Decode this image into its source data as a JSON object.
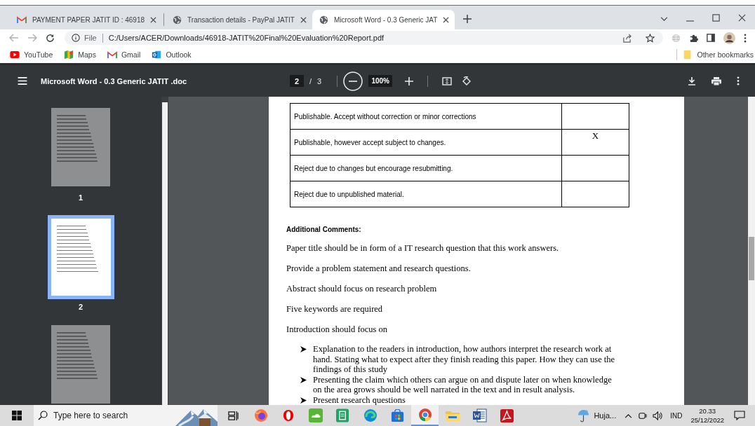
{
  "browser": {
    "tabs": [
      {
        "title": "PAYMENT PAPER JATIT ID : 46918",
        "selected": false
      },
      {
        "title": "Transaction details - PayPal JATIT",
        "selected": false
      },
      {
        "title": "Microsoft Word - 0.3 Generic JAT",
        "selected": true
      }
    ],
    "address": {
      "scheme": "File",
      "url": "C:/Users/ACER/Downloads/46918-JATIT%20Final%20Evaluation%20Report.pdf"
    },
    "bookmarks": [
      {
        "label": "YouTube"
      },
      {
        "label": "Maps"
      },
      {
        "label": "Gmail"
      },
      {
        "label": "Outlook"
      }
    ],
    "other_bookmarks": "Other bookmarks"
  },
  "pdf_toolbar": {
    "title": "Microsoft Word - 0.3 Generic JATIT .doc",
    "page": "2",
    "separator": "/",
    "page_count": "3",
    "zoom": "100%"
  },
  "thumbnails": [
    {
      "label": "1",
      "selected": false
    },
    {
      "label": "2",
      "selected": true
    },
    {
      "selected": false
    }
  ],
  "document": {
    "table_rows": [
      {
        "text": "Publishable. Accept without correction or minor corrections"
      },
      {
        "text": "Publishable, however accept subject to  changes.",
        "mark": "X"
      },
      {
        "text": "Reject due to changes but encourage resubmitting."
      },
      {
        "text": "Reject due to unpublished material."
      }
    ],
    "heading": "Additional Comments:",
    "paragraphs": [
      "Paper title should be in form of a IT research question that this work answers.",
      "Provide a problem statement and research questions.",
      "Abstract should focus on research problem",
      "Five keywords are required",
      "Introduction should focus on"
    ],
    "bullets": [
      "Explanation to the readers in introduction, how authors interpret the research work at hand.  Stating what to expect after they finish reading this paper. How they can use the findings of this study",
      "Presenting the claim which others can argue on and dispute later on when knowledge on the area grows should be well narrated in the text and in result analysis.",
      "Present research questions"
    ]
  },
  "taskbar": {
    "search_placeholder": "Type here to search",
    "apps": [
      {
        "kind": "taskview",
        "active": false
      },
      {
        "kind": "firefox",
        "active": false
      },
      {
        "kind": "opera",
        "active": false
      },
      {
        "kind": "cloud",
        "active": false
      },
      {
        "kind": "sheets",
        "active": false
      },
      {
        "kind": "edge",
        "active": false
      },
      {
        "kind": "store",
        "active": false
      },
      {
        "kind": "chrome",
        "active": true
      },
      {
        "kind": "folder",
        "active": false
      },
      {
        "kind": "word",
        "active": false
      },
      {
        "kind": "acrobat",
        "active": false
      }
    ],
    "weather": "Huja...",
    "language": "IND",
    "time": "20.33",
    "date": "25/12/2022"
  }
}
